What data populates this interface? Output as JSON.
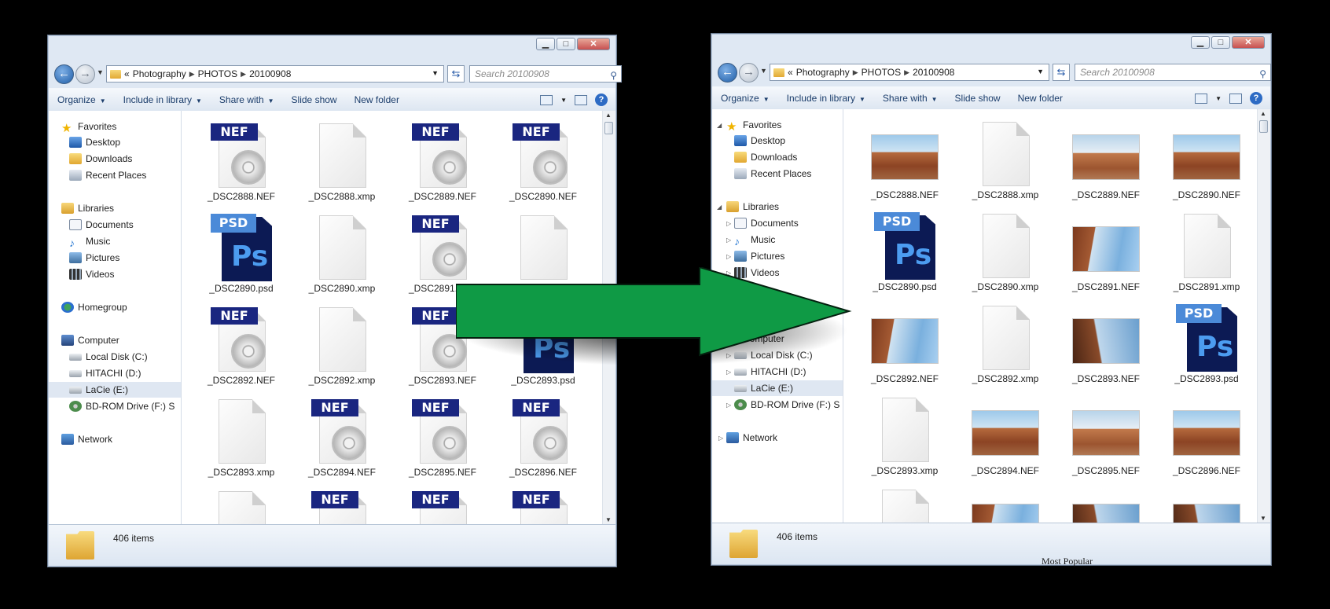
{
  "breadcrumb": [
    "«",
    "Photography",
    "PHOTOS",
    "20100908"
  ],
  "search": {
    "placeholder": "Search 20100908"
  },
  "caption": {
    "minimize": "▁",
    "maximize": "□",
    "close": "✕"
  },
  "toolbar": {
    "organize": "Organize",
    "include": "Include in library",
    "share": "Share with",
    "slideshow": "Slide show",
    "newfolder": "New folder"
  },
  "nav": {
    "favorites": "Favorites",
    "desktop": "Desktop",
    "downloads": "Downloads",
    "recent": "Recent Places",
    "libraries": "Libraries",
    "documents": "Documents",
    "music": "Music",
    "pictures": "Pictures",
    "videos": "Videos",
    "homegroup": "Homegroup",
    "computer": "Computer",
    "local_disk": "Local Disk (C:)",
    "hitachi": "HITACHI (D:)",
    "lacie": "LaCie (E:)",
    "bdrom": "BD-ROM Drive (F:) S",
    "network": "Network"
  },
  "status": {
    "items": "406 items"
  },
  "files": [
    "_DSC2888.NEF",
    "_DSC2888.xmp",
    "_DSC2889.NEF",
    "_DSC2890.NEF",
    "_DSC2890.psd",
    "_DSC2890.xmp",
    "_DSC2891.NEF",
    "_DSC2891.xmp",
    "_DSC2892.NEF",
    "_DSC2892.xmp",
    "_DSC2893.NEF",
    "_DSC2893.psd",
    "_DSC2893.xmp",
    "_DSC2894.NEF",
    "_DSC2895.NEF",
    "_DSC2896.NEF"
  ],
  "labels": {
    "nef": "NEF",
    "psd": "PSD",
    "ps": "Ps"
  },
  "footer_text": "Most Popular",
  "colors": {
    "arrow": "#0f9a45",
    "window_frame": "#dfe8f3",
    "nef_badge": "#1a2680"
  }
}
